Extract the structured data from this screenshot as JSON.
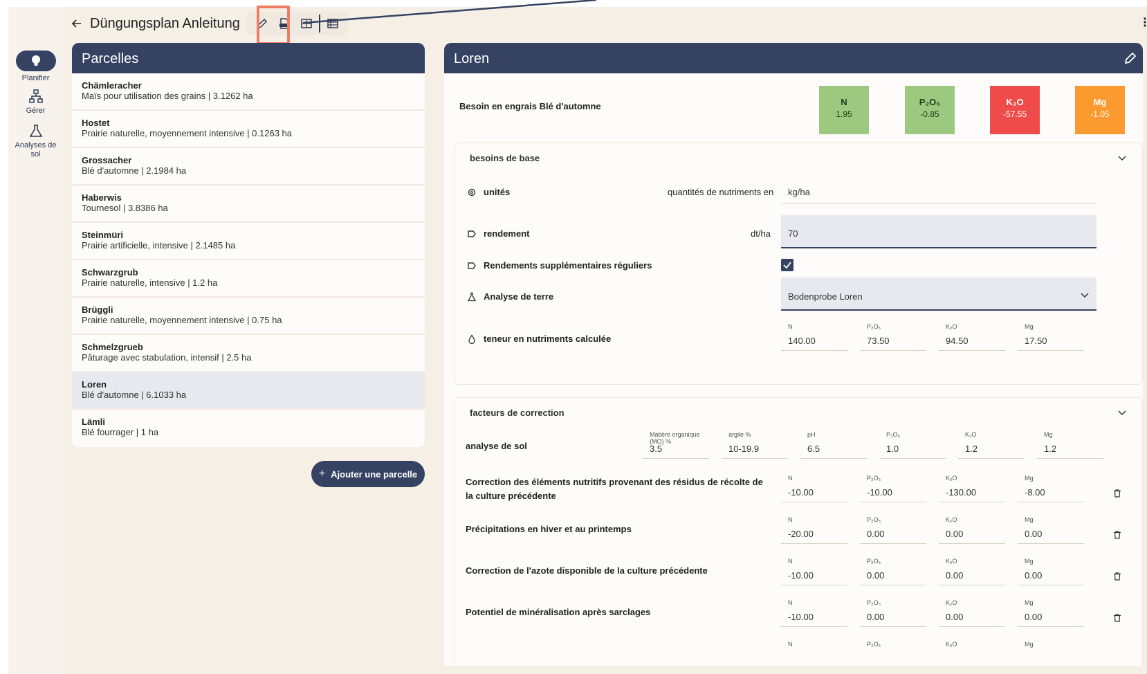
{
  "header": {
    "title": "Düngungsplan Anleitung"
  },
  "rail": {
    "items": [
      {
        "label": "Planifier"
      },
      {
        "label": "Gérer"
      },
      {
        "label": "Analyses de sol"
      }
    ]
  },
  "parcels_panel": {
    "title": "Parcelles",
    "items": [
      {
        "name": "Chämleracher",
        "desc": "Maïs pour utilisation des grains | 3.1262 ha"
      },
      {
        "name": "Hostet",
        "desc": "Prairie naturelle, moyennement intensive | 0.1263 ha"
      },
      {
        "name": "Grossacher",
        "desc": "Blé d'automne | 2.1984 ha"
      },
      {
        "name": "Haberwis",
        "desc": "Tournesol | 3.8386 ha"
      },
      {
        "name": "Steinmüri",
        "desc": "Prairie artificielle, intensive | 2.1485 ha"
      },
      {
        "name": "Schwarzgrub",
        "desc": "Prairie naturelle, intensive | 1.2 ha"
      },
      {
        "name": "Brüggli",
        "desc": "Prairie naturelle, moyennement intensive | 0.75 ha"
      },
      {
        "name": "Schmelzgrueb",
        "desc": "Pâturage avec stabulation, intensif | 2.5 ha"
      },
      {
        "name": "Loren",
        "desc": "Blé d'automne | 6.1033 ha"
      },
      {
        "name": "Lämli",
        "desc": "Blé fourrager | 1 ha"
      }
    ],
    "selected": "Loren",
    "add_label": "Ajouter une parcelle"
  },
  "detail": {
    "title": "Loren",
    "need_label": "Besoin en engrais Blé d'automne",
    "nutrients": [
      {
        "key": "N",
        "value": "1.95",
        "color": "#9cc97f"
      },
      {
        "key": "P₂O₅",
        "value": "-0.85",
        "color": "#9cc97f"
      },
      {
        "key": "K₂O",
        "value": "-57.55",
        "color": "#f04b4b"
      },
      {
        "key": "Mg",
        "value": "-1.05",
        "color": "#fb9a2e"
      }
    ],
    "base": {
      "title": "besoins de base",
      "units_label": "unités",
      "units_hint": "quantités de nutriments en",
      "units_value": "kg/ha",
      "yield_label": "rendement",
      "yield_unit": "dt/ha",
      "yield_value": "70",
      "extra_label": "Rendements supplémentaires réguliers",
      "soil_label": "Analyse de terre",
      "soil_value": "Bodenprobe Loren",
      "calc_label": "teneur en nutriments calculée",
      "calc": [
        {
          "cap": "N",
          "val": "140.00"
        },
        {
          "cap": "P₂O₅",
          "val": "73.50"
        },
        {
          "cap": "K₂O",
          "val": "94.50"
        },
        {
          "cap": "Mg",
          "val": "17.50"
        }
      ]
    },
    "correction": {
      "title": "facteurs de correction",
      "soil_row_label": "analyse de sol",
      "soil_fields": [
        {
          "cap": "Matière organique (MO) %",
          "val": "3.5"
        },
        {
          "cap": "argile %",
          "val": "10-19.9"
        },
        {
          "cap": "pH",
          "val": "6.5"
        },
        {
          "cap": "P₂O₅",
          "val": "1.0"
        },
        {
          "cap": "K₂O",
          "val": "1.2"
        },
        {
          "cap": "Mg",
          "val": "1.2"
        }
      ],
      "rows": [
        {
          "label": "Correction des éléments nutritifs provenant des résidus de récolte de la culture précédente",
          "vals": [
            "-10.00",
            "-10.00",
            "-130.00",
            "-8.00"
          ]
        },
        {
          "label": "Précipitations en hiver et au printemps",
          "vals": [
            "-20.00",
            "0.00",
            "0.00",
            "0.00"
          ]
        },
        {
          "label": "Correction de l'azote disponible de la culture précédente",
          "vals": [
            "-10.00",
            "0.00",
            "0.00",
            "0.00"
          ]
        },
        {
          "label": "Potentiel de minéralisation après sarclages",
          "vals": [
            "-10.00",
            "0.00",
            "0.00",
            "0.00"
          ]
        }
      ],
      "caps": [
        "N",
        "P₂O₅",
        "K₂O",
        "Mg"
      ]
    }
  }
}
